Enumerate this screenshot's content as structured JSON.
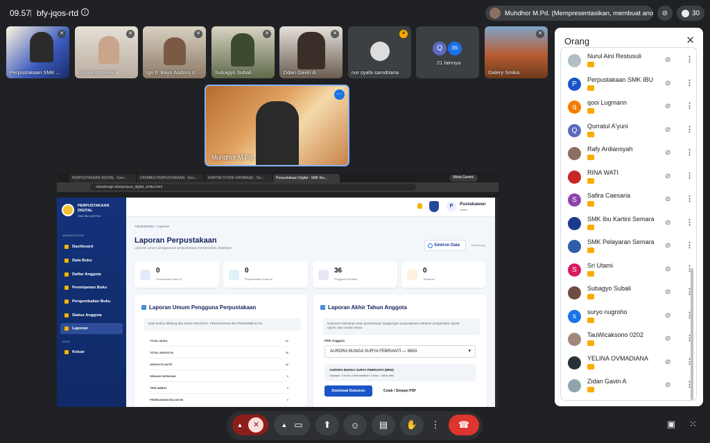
{
  "top": {
    "time": "09.57",
    "meeting_code": "bfy-jqos-rtd",
    "presenting": "Muhdhor M.Pd. (Mempresentasikan, membuat anotasi)",
    "participant_count": "30"
  },
  "tiles": [
    {
      "name": "Perpustakaan SMK ..."
    },
    {
      "name": "Gina Kismoeljani"
    },
    {
      "name": "Ign F. Bayu Andoro.s"
    },
    {
      "name": "Subagyo Subali"
    },
    {
      "name": "Zidan Gavin A"
    },
    {
      "name": "nur syafa samdriana"
    },
    {
      "name": "21 lainnya"
    },
    {
      "name": "Galery Smika"
    }
  ],
  "others_avatars": [
    "Q",
    "m"
  ],
  "speaker": {
    "name": "Muhdhor M.Pd."
  },
  "browser": {
    "tabs": [
      "PERPUSTAKAAN DIGITAL - Goo...",
      "DATABES PERPUSTAKAAN - Goo...",
      "KARTINI STORE DATABASE - Go...",
      "Perpustakaan Digital - SMK Ibu..."
    ],
    "gemini": "Minta Gemini",
    "url": "classdesign.id/ai/perpus_digital_smika.html"
  },
  "app": {
    "brand1": "PERPUSTAKAAN",
    "brand2": "DIGITAL",
    "brand3": "SMK IBU KARTINI",
    "section_admin": "ADMINISTRATOR",
    "section_akun": "AKUN",
    "nav": [
      "Dashboard",
      "Data Buku",
      "Daftar Anggota",
      "Peminjaman Buku",
      "Pengembalian Buku",
      "Status Anggota",
      "Laporan",
      "Keluar"
    ],
    "user_name": "Pustakawan",
    "user_role": "Admin",
    "user_initial": "P",
    "breadcrumb": "Administrator › Laporan",
    "title": "Laporan Perpustakaan",
    "subtitle": "Laporan umum penggunaan perpustakaan berdasarkan database.",
    "sync": "Sinkron Data",
    "sync_status": "Tersambung",
    "stats": [
      {
        "value": "0",
        "label": "Peminjaman Bulan Ini"
      },
      {
        "value": "0",
        "label": "Pengembalian Bulan Ini"
      },
      {
        "value": "36",
        "label": "Pengguna Terdaftar"
      },
      {
        "value": "0",
        "label": "Terlambat"
      }
    ],
    "report": {
      "title": "Laporan Umum Pengguna Perpustakaan",
      "note": "Data berikut dihitung dari Sheet ANGGOTA, PEMINJAMAN dan PENGEMBALIAN.",
      "rows": [
        {
          "k": "TOTAL BUKU",
          "v": "40"
        },
        {
          "k": "TOTAL ANGGOTA",
          "v": "36"
        },
        {
          "k": "ANGGOTA AKTIF",
          "v": "36"
        },
        {
          "k": "SEDANG DIPINJAM",
          "v": "0"
        },
        {
          "k": "TERLAMBAT",
          "v": "0"
        },
        {
          "k": "PEMINJAMAN BULAN INI",
          "v": "0"
        }
      ]
    },
    "year_end": {
      "title": "Laporan Akhir Tahun Anggota",
      "note1": "Dokumen individual untuk pemeriksaan tanggungan perpustakaan sebelum pengambilan ijazah,",
      "note2": "raport, atau mutasi siswa.",
      "select_label": "Pilih Anggota",
      "selected": "AURORA BUNGA SURYA FEBRIANTI — 8663",
      "member_name": "AURORA BUNGA SURYA FEBRIANTI (8663)",
      "member_status": "Dipinjam: 0 buku  •  Dikembalikan: 0 buku  •  Telat: aktu",
      "download": "Download Dokumen",
      "print": "Cetak / Simpan PDF"
    }
  },
  "panel": {
    "title": "Orang",
    "people": [
      {
        "name": "Nurul Aini Restusuli",
        "initial": "",
        "color": "#b0bec5"
      },
      {
        "name": "Perpustakaan SMK IBU ...",
        "initial": "P",
        "color": "#1a56c8"
      },
      {
        "name": "qooi Lugmann",
        "initial": "q",
        "color": "#f57c00"
      },
      {
        "name": "Qurratul A'yuni",
        "initial": "Q",
        "color": "#5c6bc0"
      },
      {
        "name": "Rafy Ardiansyah",
        "initial": "",
        "color": "#8d6e63"
      },
      {
        "name": "RINA WATI",
        "initial": "",
        "color": "#c62828"
      },
      {
        "name": "Safira Caesaria",
        "initial": "S",
        "color": "#8e44ad"
      },
      {
        "name": "SMK Ibu Kartini Semara...",
        "initial": "",
        "color": "#1a3a8c"
      },
      {
        "name": "SMK Pelayaran Semarang",
        "initial": "",
        "color": "#2e5fa8"
      },
      {
        "name": "Sri Utami",
        "initial": "S",
        "color": "#d81b60"
      },
      {
        "name": "Subagyo Subali",
        "initial": "",
        "color": "#6d4c41"
      },
      {
        "name": "suryo nugroho",
        "initial": "s",
        "color": "#1a73e8"
      },
      {
        "name": "TauWicaksono 0202",
        "initial": "",
        "color": "#a1887f"
      },
      {
        "name": "YELINA OVMADIANA",
        "initial": "",
        "color": "#263238"
      },
      {
        "name": "Zidan Gavin A",
        "initial": "",
        "color": "#90a4ae"
      }
    ]
  }
}
